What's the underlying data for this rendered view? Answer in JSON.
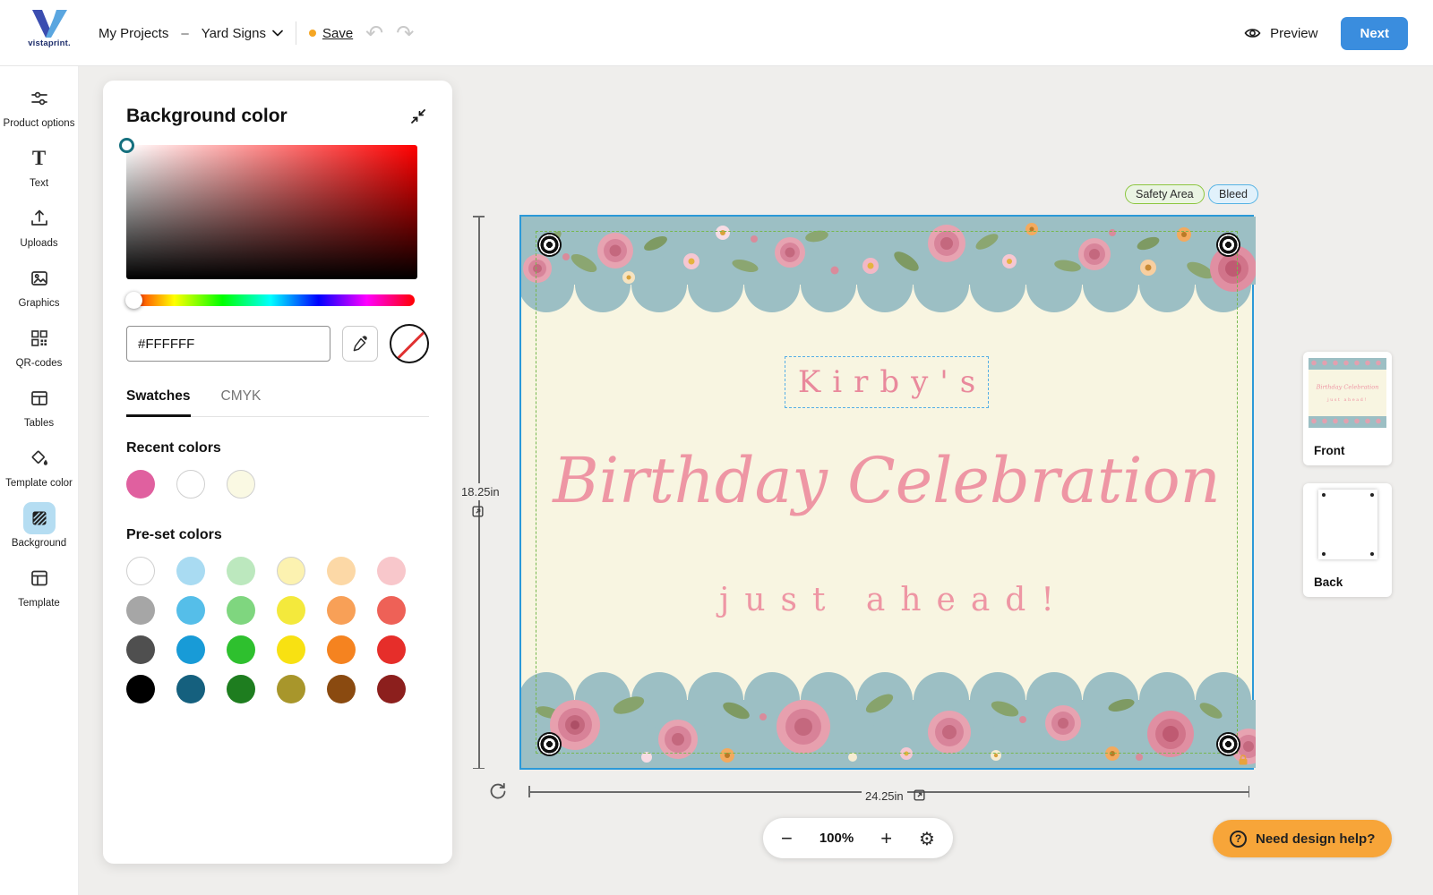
{
  "topbar": {
    "brand": "vistaprint.",
    "nav": {
      "my_projects": "My Projects",
      "separator": "–",
      "project": "Yard Signs"
    },
    "save": "Save",
    "undo_glyph": "↶",
    "redo_glyph": "↷",
    "preview": "Preview",
    "next": "Next"
  },
  "sidebar": {
    "items": [
      {
        "label": "Product options",
        "icon": "sliders-icon"
      },
      {
        "label": "Text",
        "icon": "text-icon"
      },
      {
        "label": "Uploads",
        "icon": "upload-icon"
      },
      {
        "label": "Graphics",
        "icon": "image-icon"
      },
      {
        "label": "QR-codes",
        "icon": "qr-code-icon"
      },
      {
        "label": "Tables",
        "icon": "table-icon"
      },
      {
        "label": "Template color",
        "icon": "paint-icon"
      },
      {
        "label": "Background",
        "icon": "background-icon",
        "active": true
      },
      {
        "label": "Template",
        "icon": "template-icon"
      }
    ]
  },
  "panel": {
    "title": "Background color",
    "hex": "#FFFFFF",
    "tabs": {
      "swatches": "Swatches",
      "cmyk": "CMYK"
    },
    "recent": {
      "title": "Recent colors",
      "colors": [
        "#E0609F",
        "#FFFFFF",
        "#FAF9E3"
      ]
    },
    "preset": {
      "title": "Pre-set colors",
      "colors": [
        "#FFFFFF",
        "#A9DBF2",
        "#BCE8BE",
        "#FCF2B0",
        "#FCD8A6",
        "#F8C7CB",
        "#A6A6A6",
        "#55BEE9",
        "#7FD67F",
        "#F4E93C",
        "#F8A057",
        "#EE6157",
        "#4F4F4F",
        "#189BD7",
        "#2EC02E",
        "#F8E112",
        "#F58320",
        "#E62E2A",
        "#000000",
        "#15607E",
        "#1E7D1F",
        "#A8962B",
        "#8A4A10",
        "#8C1F1D"
      ]
    }
  },
  "canvas": {
    "badges": {
      "safety": "Safety Area",
      "bleed": "Bleed"
    },
    "text": {
      "line1": "Kirby's",
      "line2": "Birthday Celebration",
      "line3": "just ahead!"
    },
    "dimensions": {
      "height": "18.25in",
      "width": "24.25in"
    }
  },
  "pages": {
    "front": "Front",
    "back": "Back"
  },
  "zoom": {
    "minus": "−",
    "value": "100%",
    "plus": "+",
    "gear_glyph": "⚙"
  },
  "help": {
    "question": "?",
    "label": "Need design help?"
  },
  "colors": {
    "accent_blue": "#3A8DDE",
    "selection_blue": "#2B99D8",
    "sidebar_active_blue": "#B5DDF2",
    "help_orange": "#F7A539",
    "save_dot_orange": "#F5A623",
    "design_pink": "#EC8FA0",
    "band_blue": "#9CBFC4",
    "canvas_cream": "#F8F5E1",
    "safety_green": "#76B84E"
  }
}
